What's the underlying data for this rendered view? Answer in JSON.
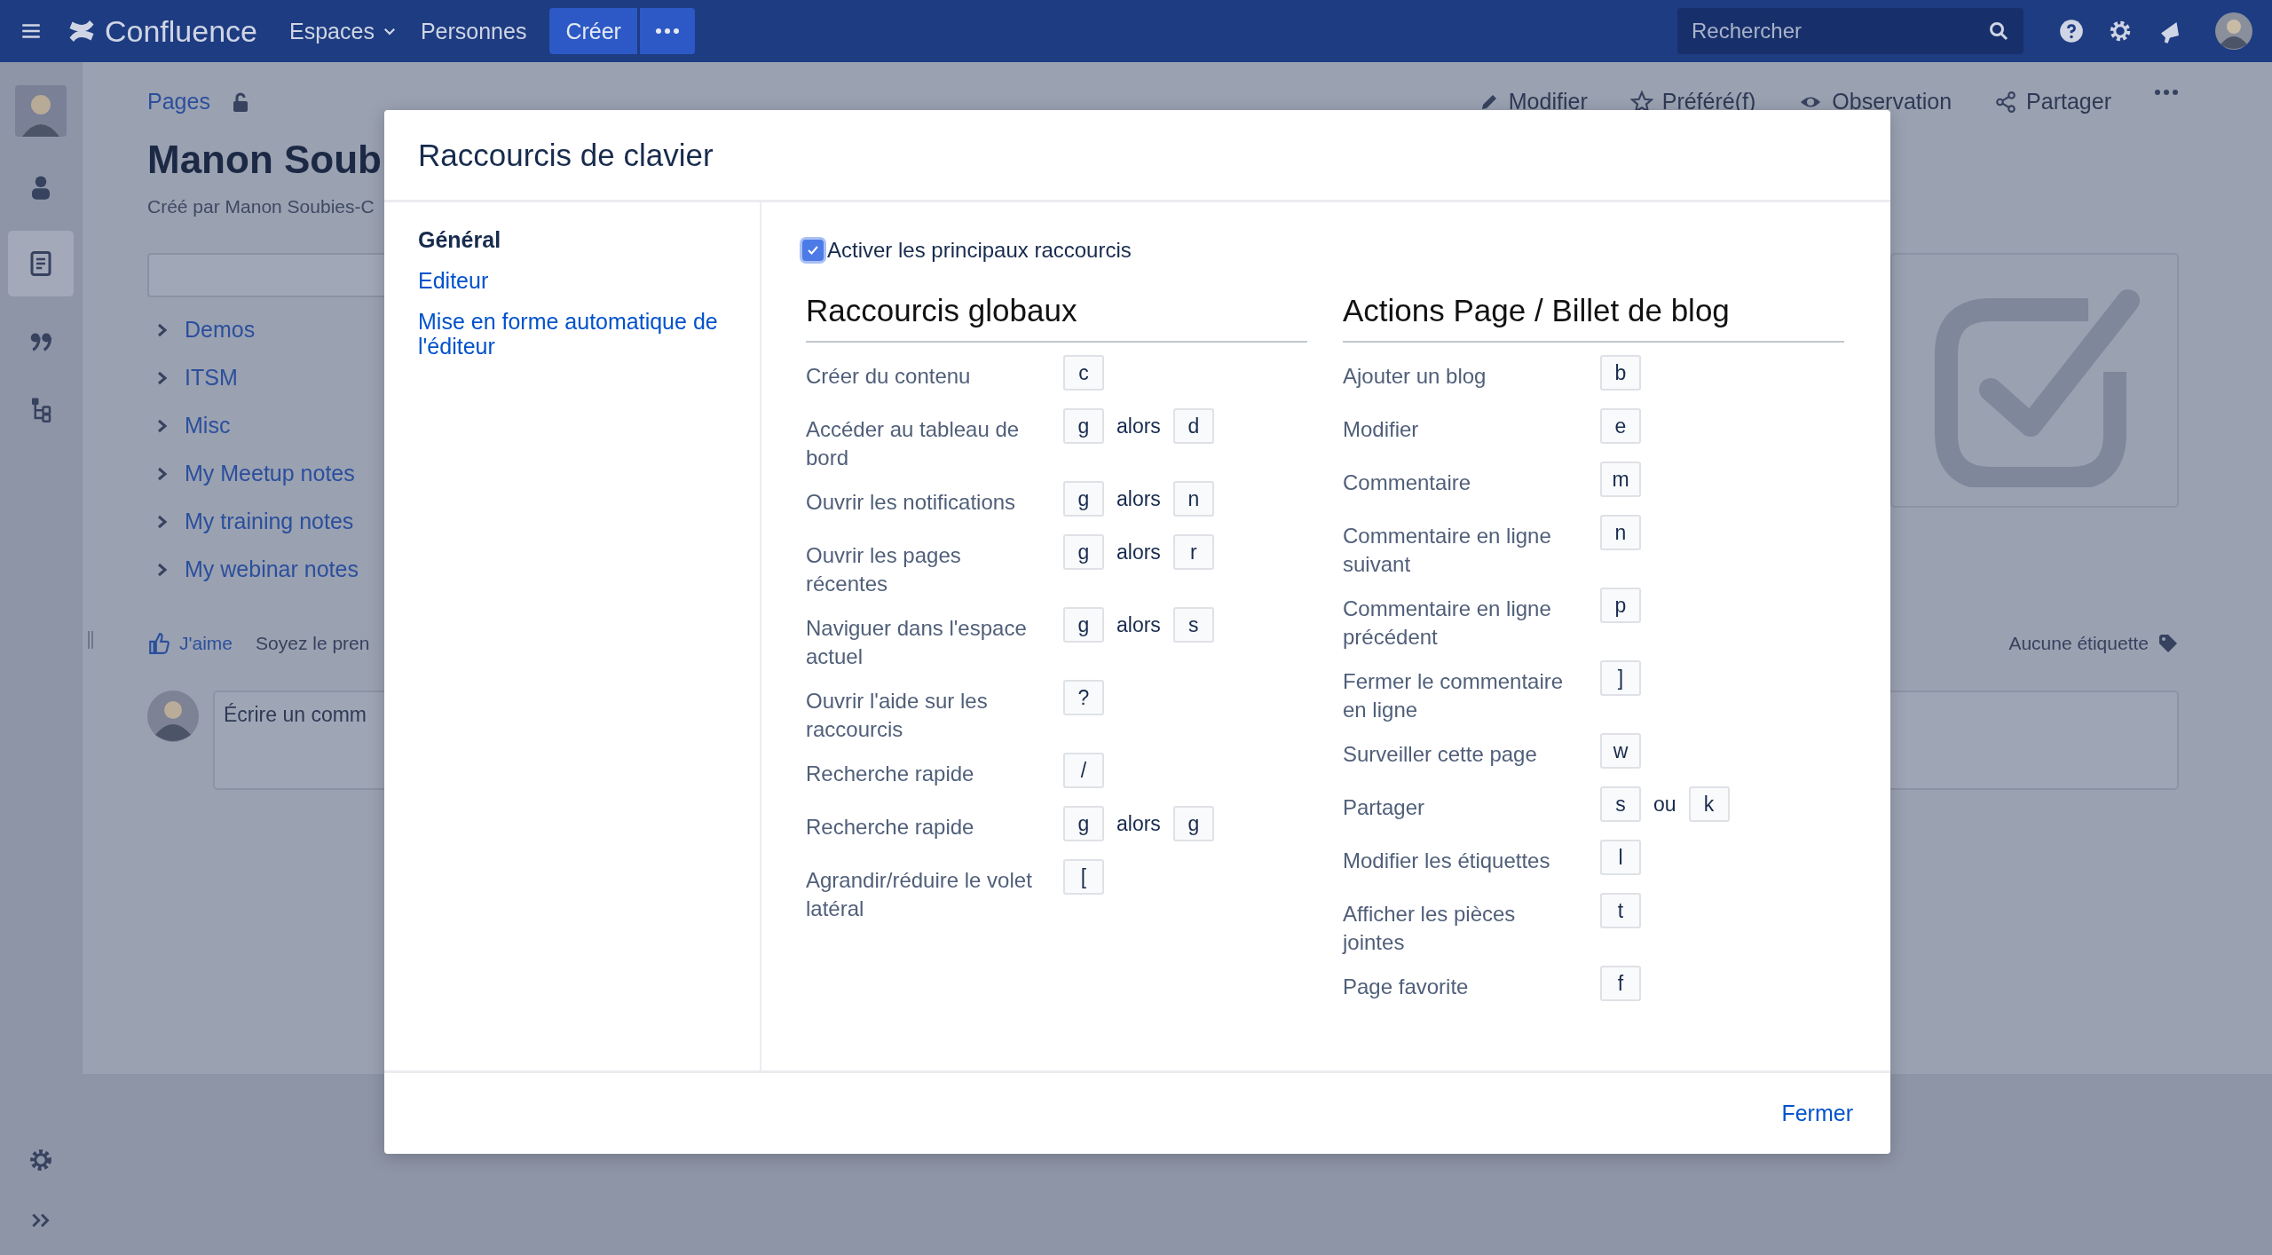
{
  "topbar": {
    "app_name": "Confluence",
    "menus": [
      {
        "label": "Espaces",
        "dropdown": true
      },
      {
        "label": "Personnes",
        "dropdown": false
      }
    ],
    "create_button": "Créer",
    "search": {
      "placeholder": "Rechercher"
    }
  },
  "sidebar": {
    "items": [
      {
        "kind": "avatar",
        "selected": false
      },
      {
        "kind": "people",
        "selected": false
      },
      {
        "kind": "pages",
        "selected": true
      },
      {
        "kind": "quote",
        "selected": false
      },
      {
        "kind": "tree",
        "selected": false
      }
    ]
  },
  "page": {
    "breadcrumb": "Pages",
    "actions": [
      {
        "kind": "edit",
        "label": "Modifier"
      },
      {
        "kind": "star",
        "label": "Préféré(f)"
      },
      {
        "kind": "watch",
        "label": "Observation"
      },
      {
        "kind": "share",
        "label": "Partager"
      }
    ],
    "title": "Manon Soub",
    "byline": "Créé par Manon Soubies-C",
    "tree": [
      "Demos",
      "ITSM",
      "Misc",
      "My Meetup notes",
      "My training notes",
      "My webinar notes"
    ],
    "like": "J'aime",
    "like_note": "Soyez le pren",
    "labels": "Aucune étiquette",
    "comment": {
      "placeholder": "Écrire un comm"
    }
  },
  "dialog": {
    "title": "Raccourcis de clavier",
    "nav": [
      {
        "label": "Général",
        "selected": true
      },
      {
        "label": "Editeur",
        "selected": false
      },
      {
        "label": "Mise en forme automatique de l'éditeur",
        "selected": false
      }
    ],
    "enable": {
      "label": "Activer les principaux raccourcis",
      "checked": true
    },
    "sections": [
      {
        "title": "Raccourcis globaux",
        "shortcuts": [
          {
            "label": "Créer du contenu",
            "keys": [
              "c"
            ]
          },
          {
            "label": "Accéder au tableau de bord",
            "keys": [
              "g",
              "d"
            ],
            "joiner": "alors"
          },
          {
            "label": "Ouvrir les notifications",
            "keys": [
              "g",
              "n"
            ],
            "joiner": "alors"
          },
          {
            "label": "Ouvrir les pages récentes",
            "keys": [
              "g",
              "r"
            ],
            "joiner": "alors"
          },
          {
            "label": "Naviguer dans l'espace actuel",
            "keys": [
              "g",
              "s"
            ],
            "joiner": "alors"
          },
          {
            "label": "Ouvrir l'aide sur les raccourcis",
            "keys": [
              "?"
            ]
          },
          {
            "label": "Recherche rapide",
            "keys": [
              "/"
            ]
          },
          {
            "label": "Recherche rapide",
            "keys": [
              "g",
              "g"
            ],
            "joiner": "alors"
          },
          {
            "label": "Agrandir/réduire le volet latéral",
            "keys": [
              "["
            ]
          }
        ]
      },
      {
        "title": "Actions Page / Billet de blog",
        "shortcuts": [
          {
            "label": "Ajouter un blog",
            "keys": [
              "b"
            ]
          },
          {
            "label": "Modifier",
            "keys": [
              "e"
            ]
          },
          {
            "label": "Commentaire",
            "keys": [
              "m"
            ]
          },
          {
            "label": "Commentaire en ligne suivant",
            "keys": [
              "n"
            ]
          },
          {
            "label": "Commentaire en ligne précédent",
            "keys": [
              "p"
            ]
          },
          {
            "label": "Fermer le commentaire en ligne",
            "keys": [
              "]"
            ]
          },
          {
            "label": "Surveiller cette page",
            "keys": [
              "w"
            ]
          },
          {
            "label": "Partager",
            "keys": [
              "s",
              "k"
            ],
            "joiner": "ou"
          },
          {
            "label": "Modifier les étiquettes",
            "keys": [
              "l"
            ]
          },
          {
            "label": "Afficher les pièces jointes",
            "keys": [
              "t"
            ]
          },
          {
            "label": "Page favorite",
            "keys": [
              "f"
            ]
          }
        ]
      }
    ],
    "close_button": "Fermer"
  }
}
